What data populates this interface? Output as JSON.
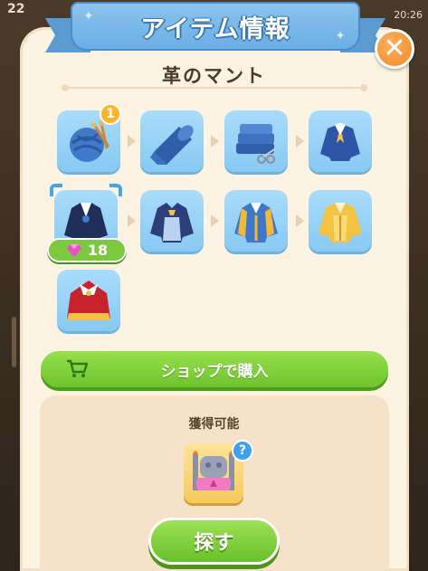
{
  "hud": {
    "left_counter": "22",
    "right_counter": "20:26"
  },
  "dialog": {
    "title": "アイテム情報",
    "item_name": "革のマント"
  },
  "chain": {
    "items": [
      {
        "icon": "yarn-knitting-icon",
        "badge": "1"
      },
      {
        "icon": "fabric-roll-icon"
      },
      {
        "icon": "folded-cloth-scissors-icon"
      },
      {
        "icon": "blue-uniform-icon"
      },
      {
        "icon": "navy-coat-icon",
        "selected": true,
        "cost": "18"
      },
      {
        "icon": "frilled-jacket-icon"
      },
      {
        "icon": "blue-gold-coat-icon"
      },
      {
        "icon": "golden-coat-icon"
      },
      {
        "icon": "red-royal-cape-icon"
      }
    ]
  },
  "shop": {
    "label": "ショップで購入"
  },
  "acquire": {
    "label": "獲得可能",
    "source_icon": "altar-throne-icon",
    "hint": "?"
  },
  "search": {
    "label": "探す"
  },
  "colors": {
    "tile": "#88c9f3",
    "accent_green": "#6fc42e",
    "close_orange": "#f08a2b",
    "ribbon": "#6aaee6"
  }
}
